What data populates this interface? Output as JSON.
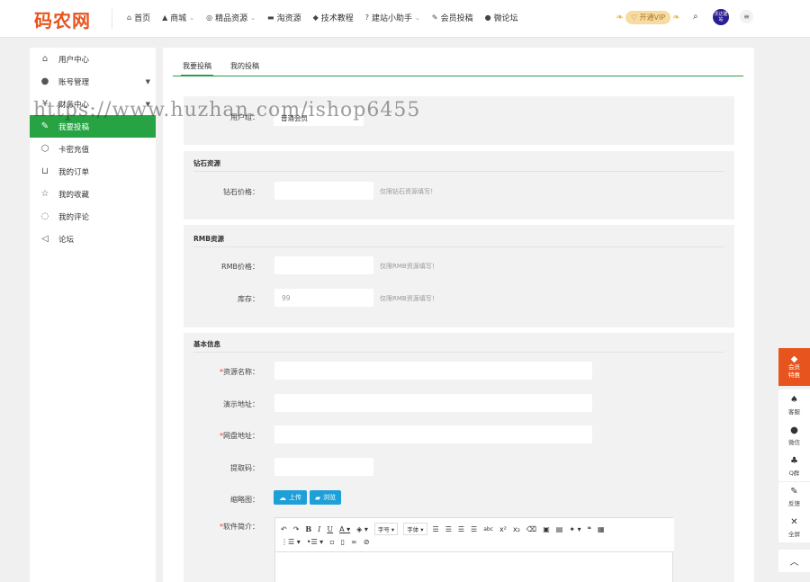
{
  "header": {
    "logo": "码农网",
    "nav": [
      {
        "icon": "home-icon",
        "glyph": "⌂",
        "label": "首页",
        "chevron": false
      },
      {
        "icon": "bank-icon",
        "glyph": "▲",
        "label": "商城",
        "chevron": true
      },
      {
        "icon": "globe-icon",
        "glyph": "◎",
        "label": "精品资源",
        "chevron": true
      },
      {
        "icon": "drive-icon",
        "glyph": "▬",
        "label": "淘资源",
        "chevron": false
      },
      {
        "icon": "graduation-icon",
        "glyph": "◆",
        "label": "技术教程",
        "chevron": false
      },
      {
        "icon": "question-icon",
        "glyph": "?",
        "label": "建站小助手",
        "chevron": true
      },
      {
        "icon": "edit-icon",
        "glyph": "✎",
        "label": "会员投稿",
        "chevron": false
      },
      {
        "icon": "comments-icon",
        "glyph": "●",
        "label": "微论坛",
        "chevron": false
      }
    ],
    "vip_label": "开通VIP",
    "avatar_text": "沃达建站"
  },
  "sidebar": {
    "items": [
      {
        "icon": "home-outline-icon",
        "glyph": "⌂",
        "label": "用户中心",
        "caret": false,
        "active": false
      },
      {
        "icon": "user-icon",
        "glyph": "●",
        "label": "账号管理",
        "caret": true,
        "active": false
      },
      {
        "icon": "finance-icon",
        "glyph": "¥",
        "label": "财务中心",
        "caret": true,
        "active": false
      },
      {
        "icon": "submit-icon",
        "glyph": "✎",
        "label": "我要投稿",
        "caret": false,
        "active": true
      },
      {
        "icon": "card-icon",
        "glyph": "⬡",
        "label": "卡密充值",
        "caret": false,
        "active": false
      },
      {
        "icon": "cart-icon",
        "glyph": "⊔",
        "label": "我的订单",
        "caret": false,
        "active": false
      },
      {
        "icon": "star-icon",
        "glyph": "☆",
        "label": "我的收藏",
        "caret": false,
        "active": false
      },
      {
        "icon": "comment-icon",
        "glyph": "◌",
        "label": "我的评论",
        "caret": false,
        "active": false
      },
      {
        "icon": "send-icon",
        "glyph": "◁",
        "label": "论坛",
        "caret": false,
        "active": false
      }
    ]
  },
  "tabs": [
    {
      "label": "我要投稿",
      "active": true
    },
    {
      "label": "我的投稿",
      "active": false
    }
  ],
  "form": {
    "user_label": "用户组：",
    "user_value": "普通会员",
    "diamond": {
      "title": "钻石资源",
      "price_label": "钻石价格：",
      "price_value": "",
      "price_hint": "仅限钻石资源填写！"
    },
    "rmb": {
      "title": "RMB资源",
      "price_label": "RMB价格：",
      "price_value": "",
      "price_hint": "仅限RMB资源填写！",
      "stock_label": "库存：",
      "stock_value": "99",
      "stock_hint": "仅限RMB资源填写！"
    },
    "basic": {
      "title": "基本信息",
      "name_label": "资源名称：",
      "demo_label": "演示地址：",
      "pan_label": "网盘地址：",
      "code_label": "提取码：",
      "thumb_label": "缩略图：",
      "upload_label": "上传",
      "browse_label": "浏览",
      "intro_label": "软件简介：",
      "required_mark": "*"
    },
    "editor": {
      "font_size_label": "字号",
      "font_family_label": "字体"
    }
  },
  "watermark": "https://www.huzhan.com/ishop6455",
  "float_bar": {
    "vip_line1": "会员",
    "vip_line2": "特惠",
    "items": [
      {
        "icon": "bell-icon",
        "glyph": "♠",
        "label": "客服"
      },
      {
        "icon": "wechat-icon",
        "glyph": "●",
        "label": "微信"
      },
      {
        "icon": "group-icon",
        "glyph": "♣",
        "label": "Q群"
      },
      {
        "icon": "feedback-icon",
        "glyph": "✎",
        "label": "反馈"
      },
      {
        "icon": "fullscreen-icon",
        "glyph": "✕",
        "label": "全屏"
      }
    ]
  },
  "colors": {
    "brand": "#e8541e",
    "active_green": "#27a344",
    "button_blue": "#1e9fd8"
  }
}
